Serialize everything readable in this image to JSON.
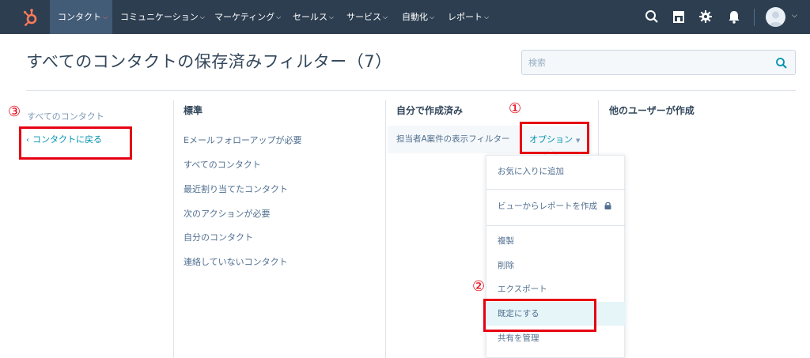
{
  "topnav": {
    "items": [
      {
        "label": "コンタクト",
        "active": true
      },
      {
        "label": "コミュニケーション"
      },
      {
        "label": "マーケティング"
      },
      {
        "label": "セールス"
      },
      {
        "label": "サービス"
      },
      {
        "label": "自動化"
      },
      {
        "label": "レポート"
      }
    ],
    "icons": [
      "search-icon",
      "marketplace-icon",
      "settings-gear-icon",
      "notification-bell-icon"
    ],
    "colors": {
      "bg": "#2d3e50",
      "active_bg": "#425b76",
      "accent": "#ff7a59"
    }
  },
  "page": {
    "title": "すべてのコンタクトの保存済みフィルター（7）",
    "search_placeholder": "検索"
  },
  "left_panel": {
    "all_contacts": "すべてのコンタクト",
    "back_link": "コンタクトに戻る"
  },
  "columns": {
    "standard": {
      "title": "標準",
      "items": [
        "Eメールフォローアップが必要",
        "すべてのコンタクト",
        "最近割り当てたコンタクト",
        "次のアクションが必要",
        "自分のコンタクト",
        "連絡していないコンタクト"
      ]
    },
    "mine": {
      "title": "自分で作成済み",
      "items": [
        "担当者A案件の表示フィルター"
      ],
      "options_label": "オプション"
    },
    "others": {
      "title": "他のユーザーが作成"
    }
  },
  "dropdown": {
    "items": [
      "お気に入りに追加",
      "ビューからレポートを作成",
      "複製",
      "削除",
      "エクスポート",
      "既定にする",
      "共有を管理"
    ]
  },
  "annotations": {
    "one": "①",
    "two": "②",
    "three": "③",
    "color": "#e60012"
  }
}
